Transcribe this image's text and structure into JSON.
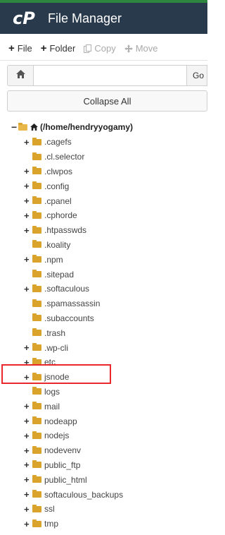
{
  "header": {
    "title": "File Manager",
    "logo_icon": "cpanel-logo-icon"
  },
  "toolbar": {
    "file_label": "File",
    "folder_label": "Folder",
    "copy_label": "Copy",
    "move_label": "Move"
  },
  "pathbar": {
    "path_value": "",
    "go_label": "Go"
  },
  "collapse_label": "Collapse All",
  "tree": {
    "root_label": "(/home/hendryyogamy)",
    "items": [
      {
        "label": ".cagefs",
        "expandable": true
      },
      {
        "label": ".cl.selector",
        "expandable": false
      },
      {
        "label": ".clwpos",
        "expandable": true
      },
      {
        "label": ".config",
        "expandable": true
      },
      {
        "label": ".cpanel",
        "expandable": true
      },
      {
        "label": ".cphorde",
        "expandable": true
      },
      {
        "label": ".htpasswds",
        "expandable": true
      },
      {
        "label": ".koality",
        "expandable": false
      },
      {
        "label": ".npm",
        "expandable": true
      },
      {
        "label": ".sitepad",
        "expandable": false
      },
      {
        "label": ".softaculous",
        "expandable": true
      },
      {
        "label": ".spamassassin",
        "expandable": false
      },
      {
        "label": ".subaccounts",
        "expandable": false
      },
      {
        "label": ".trash",
        "expandable": false
      },
      {
        "label": ".wp-cli",
        "expandable": true
      },
      {
        "label": "etc",
        "expandable": true
      },
      {
        "label": "jsnode",
        "expandable": true
      },
      {
        "label": "logs",
        "expandable": false
      },
      {
        "label": "mail",
        "expandable": true
      },
      {
        "label": "nodeapp",
        "expandable": true
      },
      {
        "label": "nodejs",
        "expandable": true
      },
      {
        "label": "nodevenv",
        "expandable": true
      },
      {
        "label": "public_ftp",
        "expandable": true
      },
      {
        "label": "public_html",
        "expandable": true
      },
      {
        "label": "softaculous_backups",
        "expandable": true
      },
      {
        "label": "ssl",
        "expandable": true
      },
      {
        "label": "tmp",
        "expandable": true
      }
    ]
  },
  "colors": {
    "header_bg": "#283a4b",
    "folder": "#d9a32c",
    "highlight": "#e8282b",
    "accent_strip": "#2e8540"
  }
}
